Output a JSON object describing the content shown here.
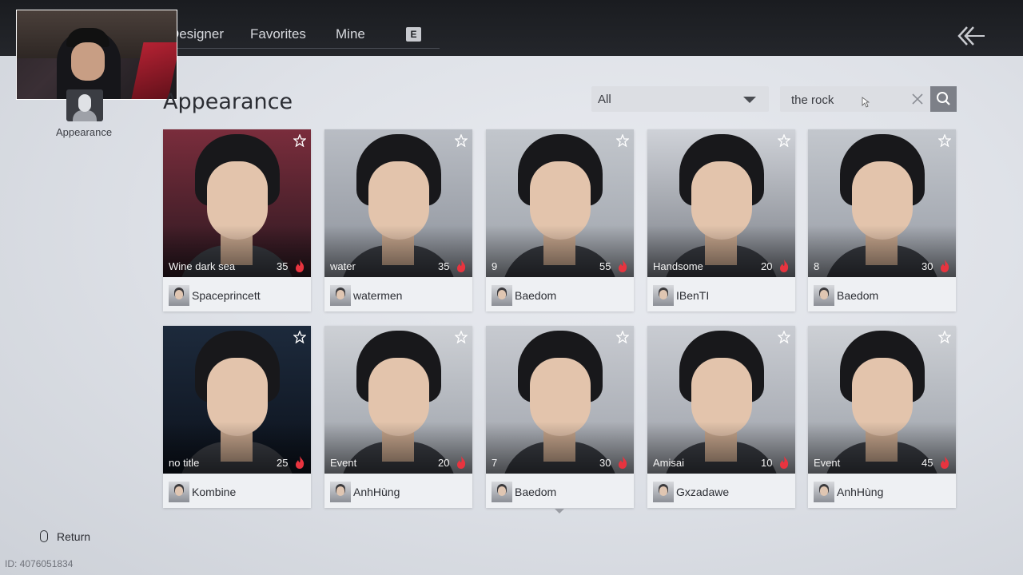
{
  "nav": {
    "tabs": [
      "Designer",
      "Favorites",
      "Mine"
    ],
    "key_hint": "E"
  },
  "sidebar": {
    "label": "Appearance"
  },
  "page": {
    "title": "Appearance"
  },
  "filter": {
    "selected": "All"
  },
  "search": {
    "value": "the rock"
  },
  "cards": [
    {
      "title": "Wine dark sea",
      "likes": "35",
      "author": "Spaceprincett"
    },
    {
      "title": "water",
      "likes": "35",
      "author": "watermen"
    },
    {
      "title": "9",
      "likes": "55",
      "author": "Baedom"
    },
    {
      "title": "Handsome",
      "likes": "20",
      "author": "IBenTI"
    },
    {
      "title": "8",
      "likes": "30",
      "author": "Baedom"
    },
    {
      "title": "no title",
      "likes": "25",
      "author": "Kombine"
    },
    {
      "title": "Event",
      "likes": "20",
      "author": "AnhHùng"
    },
    {
      "title": "7",
      "likes": "30",
      "author": "Baedom"
    },
    {
      "title": "Amisai",
      "likes": "10",
      "author": "Gxzadawe"
    },
    {
      "title": "Event",
      "likes": "45",
      "author": "AnhHùng"
    }
  ],
  "footer": {
    "return_label": "Return",
    "id_text": "ID: 4076051834"
  },
  "colors": {
    "fire": "#e8343f",
    "star": "#ffffff",
    "topbar": "#1e2024"
  }
}
